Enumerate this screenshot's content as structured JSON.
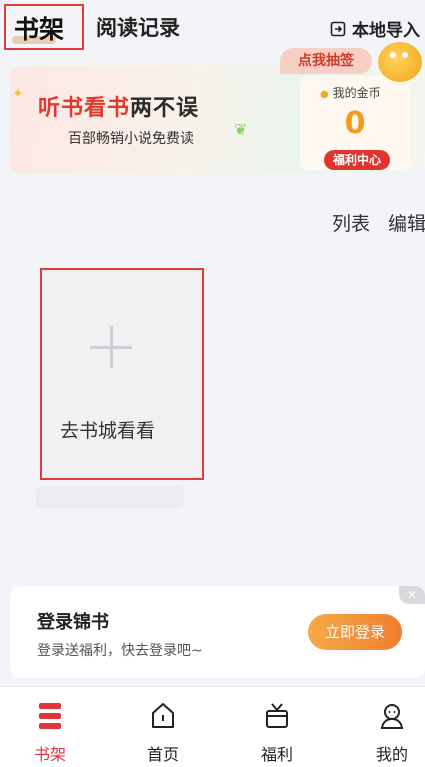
{
  "header": {
    "tab_shelf": "书架",
    "tab_history": "阅读记录",
    "import_label": "本地导入"
  },
  "banner": {
    "headline_part1": "听书看书",
    "headline_part2": "两不误",
    "subtitle": "百部畅销小说免费读",
    "lottery_label": "点我抽签",
    "coin_label": "我的金币",
    "coin_value": "0",
    "welfare_button": "福利中心"
  },
  "shelf_actions": {
    "list_label": "列表",
    "edit_label": "编辑"
  },
  "add_card": {
    "label": "去书城看看"
  },
  "login_prompt": {
    "title": "登录锦书",
    "description": "登录送福利，快去登录吧~",
    "button": "立即登录",
    "close_icon": "close-icon"
  },
  "bottom_nav": {
    "items": [
      {
        "label": "书架",
        "icon": "bookshelf-icon",
        "active": true
      },
      {
        "label": "首页",
        "icon": "home-icon",
        "active": false
      },
      {
        "label": "福利",
        "icon": "gift-icon",
        "active": false
      },
      {
        "label": "我的",
        "icon": "profile-icon",
        "active": false
      }
    ]
  },
  "colors": {
    "accent_red": "#e0353a",
    "coin_orange": "#f39b1a",
    "login_button_orange": "#ef7e2d"
  }
}
